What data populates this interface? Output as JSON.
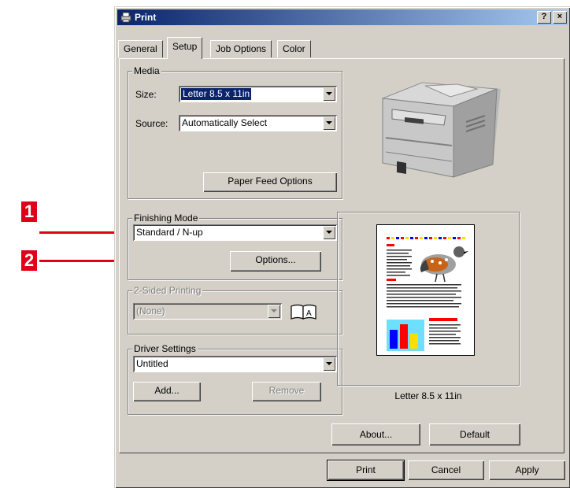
{
  "window": {
    "title": "Print",
    "help_btn": "?",
    "close_btn": "×"
  },
  "tabs": [
    "General",
    "Setup",
    "Job Options",
    "Color"
  ],
  "media": {
    "group_title": "Media",
    "size_label": "Size:",
    "size_value": "Letter 8.5 x 11in",
    "source_label": "Source:",
    "source_value": "Automatically Select",
    "paper_feed_button": "Paper Feed Options"
  },
  "finishing": {
    "group_title": "Finishing Mode",
    "mode_value": "Standard / N-up",
    "options_button": "Options..."
  },
  "two_sided": {
    "group_title": "2-Sided Printing",
    "value": "(None)"
  },
  "driver": {
    "group_title": "Driver Settings",
    "value": "Untitled",
    "add_button": "Add...",
    "remove_button": "Remove"
  },
  "preview": {
    "caption": "Letter 8.5 x 11in"
  },
  "footer": {
    "about_button": "About...",
    "default_button": "Default",
    "print_button": "Print",
    "cancel_button": "Cancel",
    "apply_button": "Apply"
  },
  "callouts": [
    "1",
    "2"
  ],
  "colors": {
    "callout": "#e1001a",
    "title_start": "#0a246a",
    "title_end": "#a6caf0",
    "face": "#d4d0c8"
  }
}
